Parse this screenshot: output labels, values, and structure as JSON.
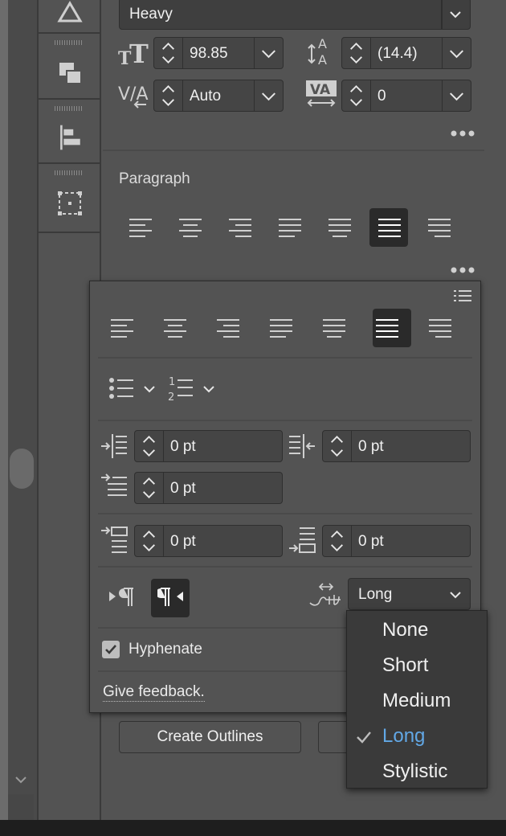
{
  "character": {
    "font_style": "Heavy",
    "font_size": "98.85",
    "leading": "(14.4)",
    "kerning": "Auto",
    "tracking": "0"
  },
  "paragraph": {
    "section_title": "Paragraph",
    "selected_alignment": "justify-all"
  },
  "popover": {
    "indent_left": "0 pt",
    "indent_right": "0 pt",
    "indent_first_line": "0 pt",
    "space_before": "0 pt",
    "space_after": "0 pt",
    "kashida_value": "Long",
    "hyphenate_label": "Hyphenate",
    "hyphenate_checked": true,
    "feedback_label": "Give feedback."
  },
  "quick_actions": {
    "create_outlines_label": "Create Outlines"
  },
  "kashida_menu": {
    "options": [
      "None",
      "Short",
      "Medium",
      "Long",
      "Stylistic"
    ],
    "selected": "Long"
  },
  "colors": {
    "panel_bg": "#535353",
    "field_bg": "#3f3f3f",
    "selected_accent": "#62a8e6"
  }
}
